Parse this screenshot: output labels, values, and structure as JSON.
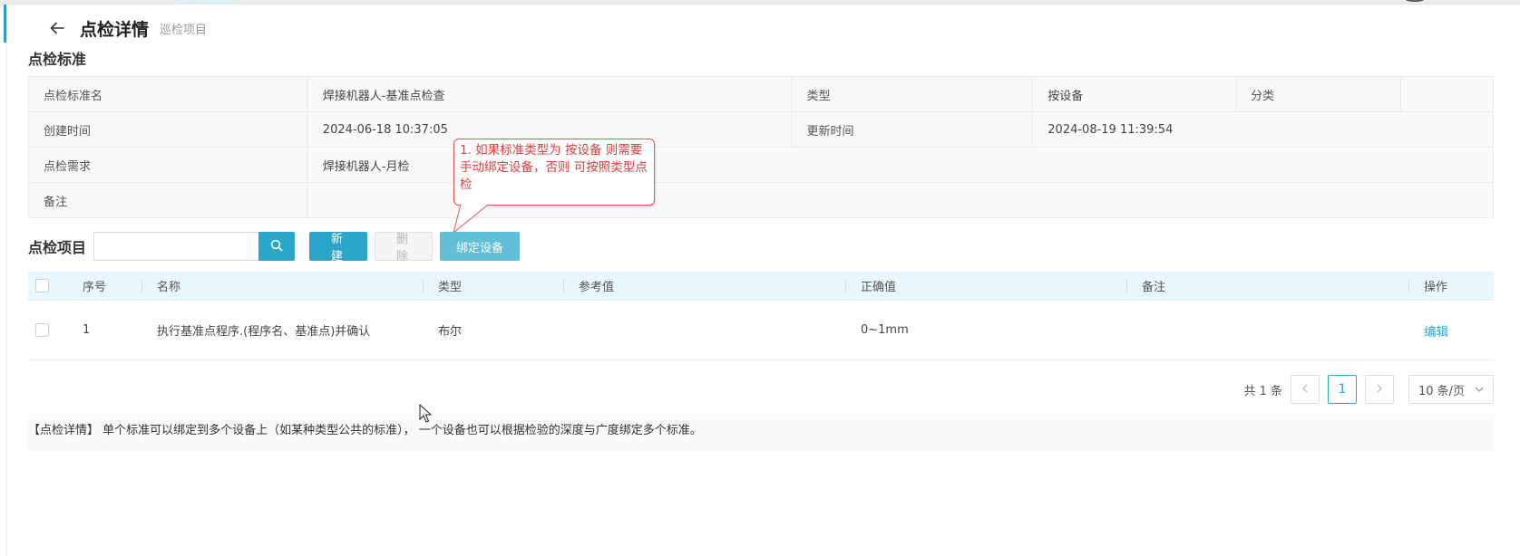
{
  "header": {
    "title": "点检详情",
    "subtitle": "巡检项目"
  },
  "standard_section": {
    "title": "点检标准",
    "rows": [
      [
        {
          "label": "点检标准名",
          "value": "焊接机器人-基准点检查"
        },
        {
          "label": "类型",
          "value": "按设备"
        },
        {
          "label": "分类",
          "value": ""
        }
      ],
      [
        {
          "label": "创建时间",
          "value": "2024-06-18 10:37:05"
        },
        {
          "label": "更新时间",
          "value": "2024-08-19 11:39:54"
        }
      ],
      [
        {
          "label": "点检需求",
          "value": "焊接机器人-月检"
        }
      ],
      [
        {
          "label": "备注",
          "value": ""
        }
      ]
    ]
  },
  "items_section": {
    "title": "点检项目",
    "search": {
      "value": "",
      "placeholder": ""
    },
    "buttons": {
      "new": "新 建",
      "delete": "删 除",
      "bind": "绑定设备"
    }
  },
  "callout": {
    "text": "1. 如果标准类型为 按设备 则需要手动绑定设备，否则 可按照类型点检"
  },
  "table": {
    "columns": [
      "序号",
      "名称",
      "类型",
      "参考值",
      "正确值",
      "备注",
      "操作"
    ],
    "rows": [
      {
        "no": "1",
        "name": "执行基准点程序.(程序名、基准点)并确认",
        "type": "布尔",
        "ref": "",
        "correct": "0~1mm",
        "remark": "",
        "action": "编辑"
      }
    ]
  },
  "pagination": {
    "total": "共 1 条",
    "current": "1",
    "page_size": "10 条/页"
  },
  "note": "【点检详情】 单个标准可以绑定到多个设备上（如某种类型公共的标准）， 一个设备也可以根据检验的深度与广度绑定多个标准。",
  "colors": {
    "accent": "#2aa7c8",
    "callout": "#e03a3a",
    "header_bg": "#e8f7fb"
  }
}
